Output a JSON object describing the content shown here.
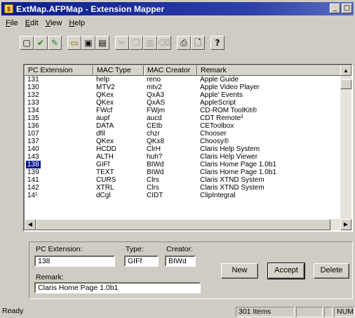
{
  "window": {
    "title": "ExtMap.AFPMap - Extension Mapper"
  },
  "menu": [
    "File",
    "Edit",
    "View",
    "Help"
  ],
  "toolbar": {
    "icons": [
      "new-doc-icon",
      "check-icon",
      "pencil-icon",
      "open-folder-icon",
      "save-icon",
      "save-all-icon",
      "cut-icon",
      "copy-icon",
      "paste-icon",
      "clear-icon",
      "print-icon",
      "print-preview-icon",
      "help-icon"
    ]
  },
  "list": {
    "headers": [
      "PC Extension",
      "MAC Type",
      "MAC Creator",
      "Remark"
    ],
    "rows": [
      [
        "131",
        "help",
        "reno",
        "Apple Guide"
      ],
      [
        "130",
        "MTV2",
        "mtv2",
        "Apple Video Player"
      ],
      [
        "132",
        "QKex",
        "QxA3",
        "Apple' Events"
      ],
      [
        "133",
        "QKex",
        "QxAS",
        "AppleScript"
      ],
      [
        "134",
        "FWcf",
        "FWjm",
        "CD-ROM ToolKit®"
      ],
      [
        "135",
        "aupf",
        "aucd",
        "CDT Remote³"
      ],
      [
        "136",
        "DATA",
        "CEtb",
        "CEToolbox"
      ],
      [
        "107",
        "dfil",
        "chzr",
        "Chooser"
      ],
      [
        "137",
        "QKex",
        "QKx8",
        "Choosy®"
      ],
      [
        "140",
        "HCDD",
        "ClrH",
        "Claris Help System"
      ],
      [
        "143",
        "ALTH",
        "huh?",
        "Claris Help Viewer"
      ],
      [
        "138",
        "GIFf",
        "BIWd",
        "Claris Home Page 1.0b1"
      ],
      [
        "139",
        "TEXT",
        "BIWd",
        "Claris Home Page 1.0b1"
      ],
      [
        "141",
        "CURS",
        "Clrs",
        "Claris XTND System"
      ],
      [
        "142",
        "XTRL",
        "Clrs",
        "Claris XTND System"
      ],
      [
        "14¹",
        "dCgl",
        "CIDT",
        "ClipIntegral"
      ]
    ],
    "selected_index": 11
  },
  "editor": {
    "pc_extension_label": "PC Extension:",
    "pc_extension_value": "138",
    "type_label": "Type:",
    "type_value": "GIFf",
    "creator_label": "Creator:",
    "creator_value": "BIWd",
    "remark_label": "Remark:",
    "remark_value": "Claris Home Page 1.0b1",
    "new_label": "New",
    "accept_label": "Accept",
    "delete_label": "Delete"
  },
  "status": {
    "text": "Ready",
    "items": "301 Items",
    "num": "NUM"
  }
}
